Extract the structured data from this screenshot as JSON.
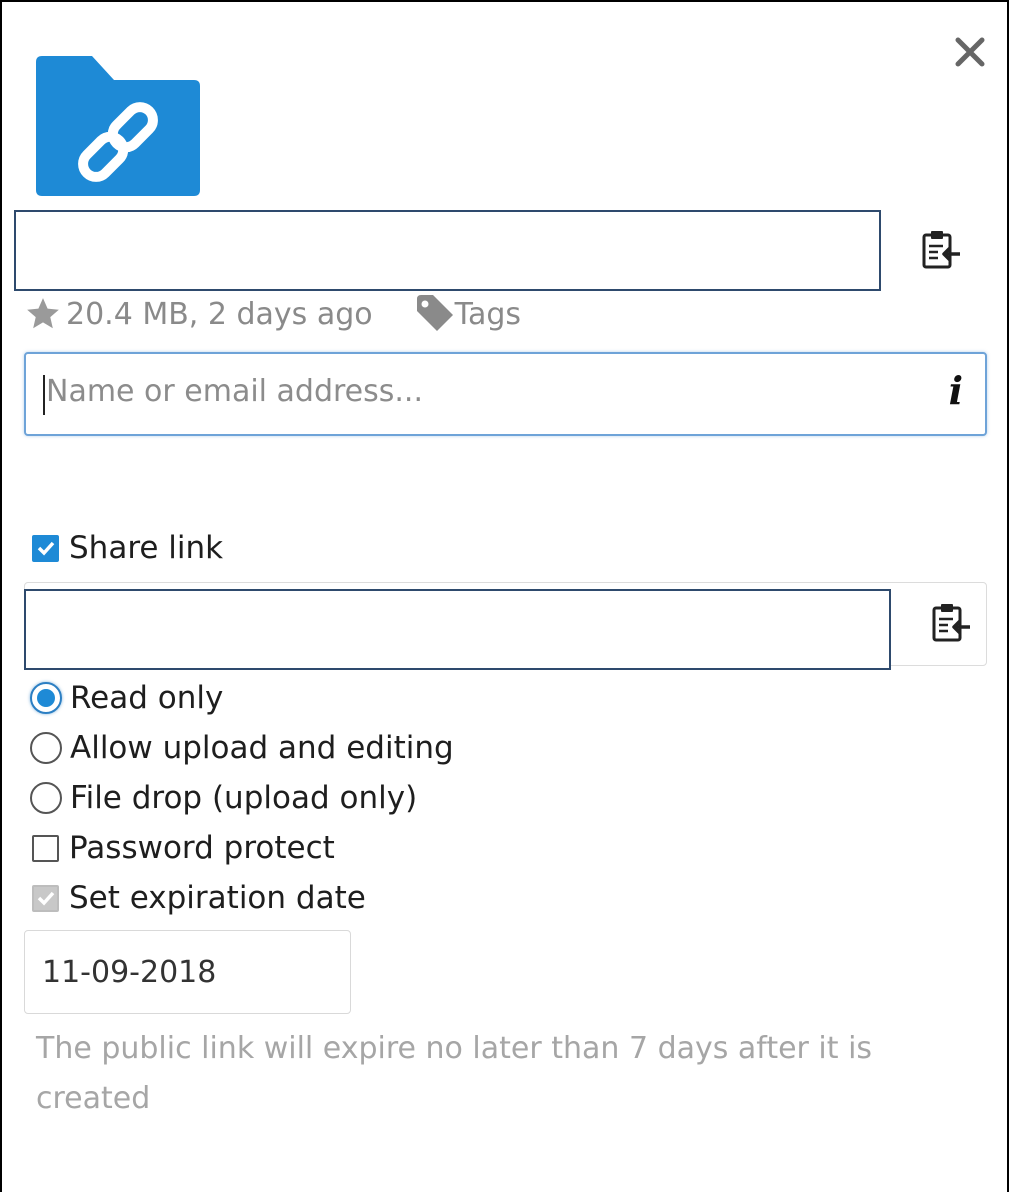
{
  "header": {
    "close_icon": "close-icon",
    "folder_icon": "shared-link-folder-icon",
    "folder_color": "#1e8ad6",
    "copy_icon": "clipboard-icon"
  },
  "file": {
    "name_value": "",
    "size_and_date": "20.4 MB, 2 days ago",
    "tags_label": "Tags",
    "favorite_icon": "star-icon",
    "tags_icon": "tag-icon"
  },
  "share": {
    "placeholder": "Name or email address...",
    "info_label": "i"
  },
  "link": {
    "share_link_label": "Share link",
    "share_link_checked": true,
    "url_value": "",
    "permissions": [
      {
        "label": "Read only",
        "selected": true
      },
      {
        "label": "Allow upload and editing",
        "selected": false
      },
      {
        "label": "File drop (upload only)",
        "selected": false
      }
    ],
    "password_label": "Password protect",
    "password_checked": false,
    "expiration_label": "Set expiration date",
    "expiration_checked": true,
    "expiration_disabled": true,
    "expiration_date": "11-09-2018",
    "expiration_hint": "The public link will expire no later than 7 days after it is created"
  },
  "colors": {
    "accent": "#1e8ad6",
    "muted_text": "#a6a6a6",
    "field_border": "#2e4a6d"
  }
}
